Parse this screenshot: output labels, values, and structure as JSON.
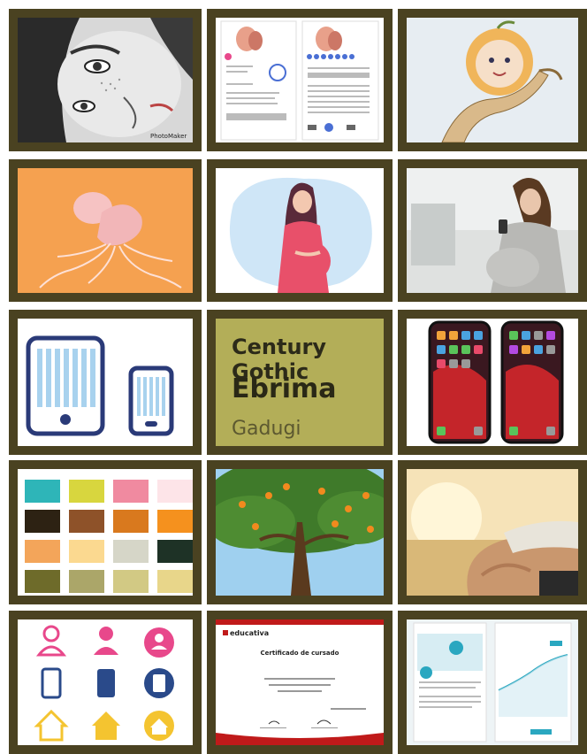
{
  "tiles": [
    {
      "name": "freckled-girl-drawing",
      "caption": "PhotoMaker"
    },
    {
      "name": "pregnancy-app-screens"
    },
    {
      "name": "baby-in-orange-drawing"
    },
    {
      "name": "fetus-illustration"
    },
    {
      "name": "pregnant-woman-illustration"
    },
    {
      "name": "pregnant-woman-phone-photo"
    },
    {
      "name": "tablet-phone-icons"
    },
    {
      "name": "font-samples"
    },
    {
      "name": "iphone-mockups"
    },
    {
      "name": "color-palette"
    },
    {
      "name": "orange-tree-photo"
    },
    {
      "name": "pregnant-belly-photo"
    },
    {
      "name": "icon-set"
    },
    {
      "name": "certificate"
    },
    {
      "name": "app-screens-blue"
    }
  ],
  "fonts": {
    "century": "Century Gothic",
    "ebrima": "Ebrima",
    "gadugi": "Gadugi"
  },
  "certificate": {
    "brand": "educativa",
    "title": "Certificado de cursado"
  },
  "palette": [
    "#2eb5b8",
    "#d8d63e",
    "#f08aa0",
    "#fde4e8",
    "#2d2213",
    "#8e5229",
    "#d9791e",
    "#f5911e",
    "#f3a55a",
    "#fbd990",
    "#d6d6c8",
    "#1e3226",
    "#6e6b2a",
    "#aba669",
    "#d2c984",
    "#e8d68a"
  ],
  "accent": {
    "frame": "#4a4221",
    "pink": "#e8488b",
    "blue": "#2a4a8a",
    "yellow": "#f4c430"
  }
}
